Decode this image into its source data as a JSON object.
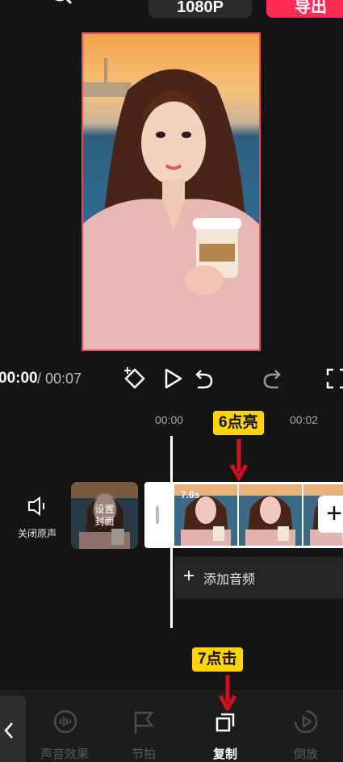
{
  "header": {
    "resolution_label": "1080P",
    "export_label": "导出"
  },
  "player": {
    "current_time": "00:00",
    "total_time": "/ 00:07"
  },
  "timeline": {
    "ruler": [
      "00:00",
      "00:02"
    ],
    "mute_label": "关闭原声",
    "cover_label_line1": "设置",
    "cover_label_line2": "封面",
    "clip_duration": "7.6s",
    "add_audio_label": "添加音频"
  },
  "annotations": {
    "step6": "6点亮",
    "step7": "7点击"
  },
  "toolbar": {
    "items": [
      {
        "label": "声音效果",
        "icon": "sound-effect-icon"
      },
      {
        "label": "节拍",
        "icon": "beat-flag-icon"
      },
      {
        "label": "复制",
        "icon": "copy-icon"
      },
      {
        "label": "倒放",
        "icon": "reverse-play-icon"
      }
    ]
  },
  "colors": {
    "accent": "#fe2c55",
    "callout": "#ffd400",
    "arrow": "#d1101e"
  }
}
